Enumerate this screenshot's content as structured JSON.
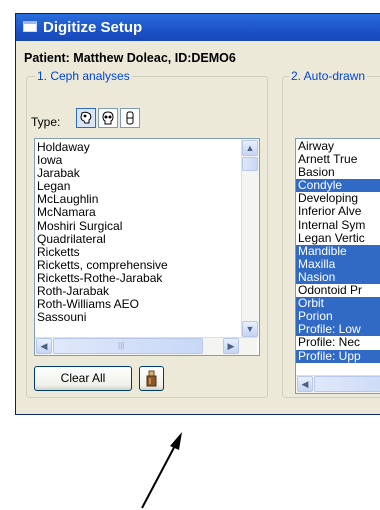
{
  "window": {
    "title": "Digitize Setup"
  },
  "patient_line": "Patient: Matthew Doleac, ID:DEMO6",
  "ceph": {
    "legend": "1. Ceph analyses",
    "type_label": "Type:",
    "type_icons": [
      "skull-side-icon",
      "skull-front-icon",
      "tooth-icon"
    ],
    "items": [
      "Holdaway",
      "Iowa",
      "Jarabak",
      "Legan",
      "McLaughlin",
      "McNamara",
      "Moshiri Surgical",
      "Quadrilateral",
      "Ricketts",
      "Ricketts, comprehensive",
      "Ricketts-Rothe-Jarabak",
      "Roth-Jarabak",
      "Roth-Williams AEO",
      "Sassouni"
    ]
  },
  "autodraw": {
    "legend": "2. Auto-drawn",
    "items": [
      {
        "label": "Airway",
        "selected": false
      },
      {
        "label": "Arnett True",
        "selected": false
      },
      {
        "label": "Basion",
        "selected": false
      },
      {
        "label": "Condyle",
        "selected": true
      },
      {
        "label": "Developing",
        "selected": false
      },
      {
        "label": "Inferior Alve",
        "selected": false
      },
      {
        "label": "Internal Sym",
        "selected": false
      },
      {
        "label": "Legan Vertic",
        "selected": false
      },
      {
        "label": "Mandible",
        "selected": true
      },
      {
        "label": "Maxilla",
        "selected": true
      },
      {
        "label": "Nasion",
        "selected": true
      },
      {
        "label": "Odontoid Pr",
        "selected": false
      },
      {
        "label": "Orbit",
        "selected": true
      },
      {
        "label": "Porion",
        "selected": true
      },
      {
        "label": "Profile: Low",
        "selected": true
      },
      {
        "label": "Profile: Nec",
        "selected": false
      },
      {
        "label": "Profile: Upp",
        "selected": true
      }
    ]
  },
  "buttons": {
    "clear_all": "Clear All",
    "extra_icon": "tool-icon"
  },
  "colors": {
    "titlebar": "#1c53c9",
    "selection": "#316ac5",
    "group_text": "#0046d5"
  }
}
